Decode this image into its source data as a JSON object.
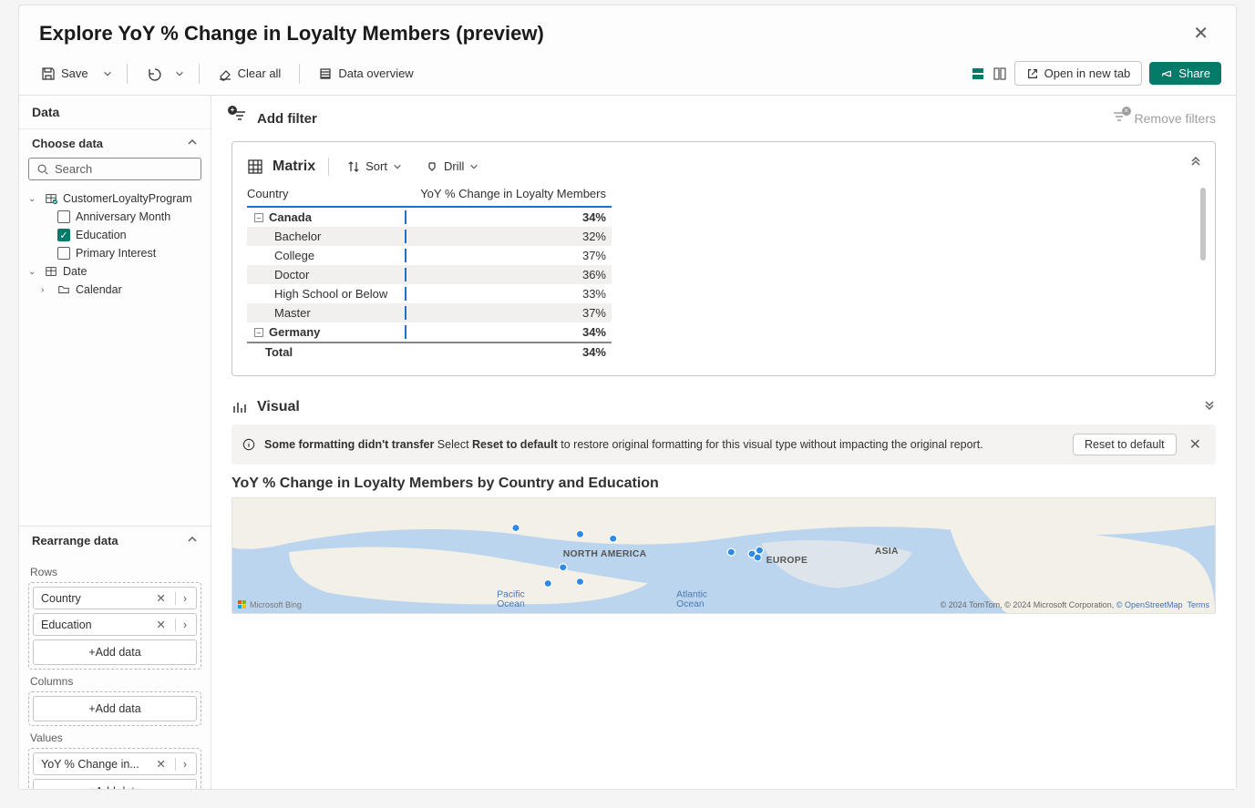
{
  "title": "Explore YoY % Change in Loyalty Members (preview)",
  "toolbar": {
    "save": "Save",
    "clear_all": "Clear all",
    "data_overview": "Data overview",
    "open_new_tab": "Open in new tab",
    "share": "Share"
  },
  "sidebar": {
    "data_header": "Data",
    "choose_data": "Choose data",
    "search_placeholder": "Search",
    "tree": {
      "table1": "CustomerLoyaltyProgram",
      "fields": {
        "anniv": {
          "label": "Anniversary Month",
          "checked": false
        },
        "edu": {
          "label": "Education",
          "checked": true
        },
        "prim": {
          "label": "Primary Interest",
          "checked": false
        }
      },
      "table2": "Date",
      "calendar": "Calendar"
    },
    "rearrange": "Rearrange data",
    "labels": {
      "rows": "Rows",
      "columns": "Columns",
      "values": "Values"
    },
    "tokens": {
      "country": "Country",
      "education": "Education",
      "yoy": "YoY % Change in..."
    },
    "add_data": "+Add data"
  },
  "filters": {
    "add": "Add filter",
    "remove": "Remove filters"
  },
  "matrix": {
    "title": "Matrix",
    "sort": "Sort",
    "drill": "Drill",
    "col1": "Country",
    "col2": "YoY % Change in Loyalty Members",
    "rows": [
      {
        "label": "Canada",
        "value": "34%",
        "group": true
      },
      {
        "label": "Bachelor",
        "value": "32%",
        "alt": true
      },
      {
        "label": "College",
        "value": "37%"
      },
      {
        "label": "Doctor",
        "value": "36%",
        "alt": true
      },
      {
        "label": "High School or Below",
        "value": "33%"
      },
      {
        "label": "Master",
        "value": "37%",
        "alt": true
      },
      {
        "label": "Germany",
        "value": "34%",
        "group": true
      },
      {
        "label": "Total",
        "value": "34%",
        "total": true
      }
    ]
  },
  "visual": {
    "header": "Visual",
    "banner_prefix": "Some formatting didn't transfer",
    "banner_mid1": " Select ",
    "banner_bold": "Reset to default",
    "banner_mid2": " to restore original formatting for this visual type without impacting the original report.",
    "reset": "Reset to default",
    "chart_title": "YoY % Change in Loyalty Members by Country and Education",
    "map_labels": {
      "na": "NORTH AMERICA",
      "eu": "EUROPE",
      "asia": "ASIA",
      "pac": "Pacific",
      "ocean1": "Ocean",
      "atl": "Atlantic",
      "ocean2": "Ocean"
    },
    "bing": "Microsoft Bing",
    "attrib_prefix": "© 2024 TomTom, © 2024 Microsoft Corporation, ",
    "attrib_osm": "© OpenStreetMap",
    "attrib_terms": "Terms"
  }
}
